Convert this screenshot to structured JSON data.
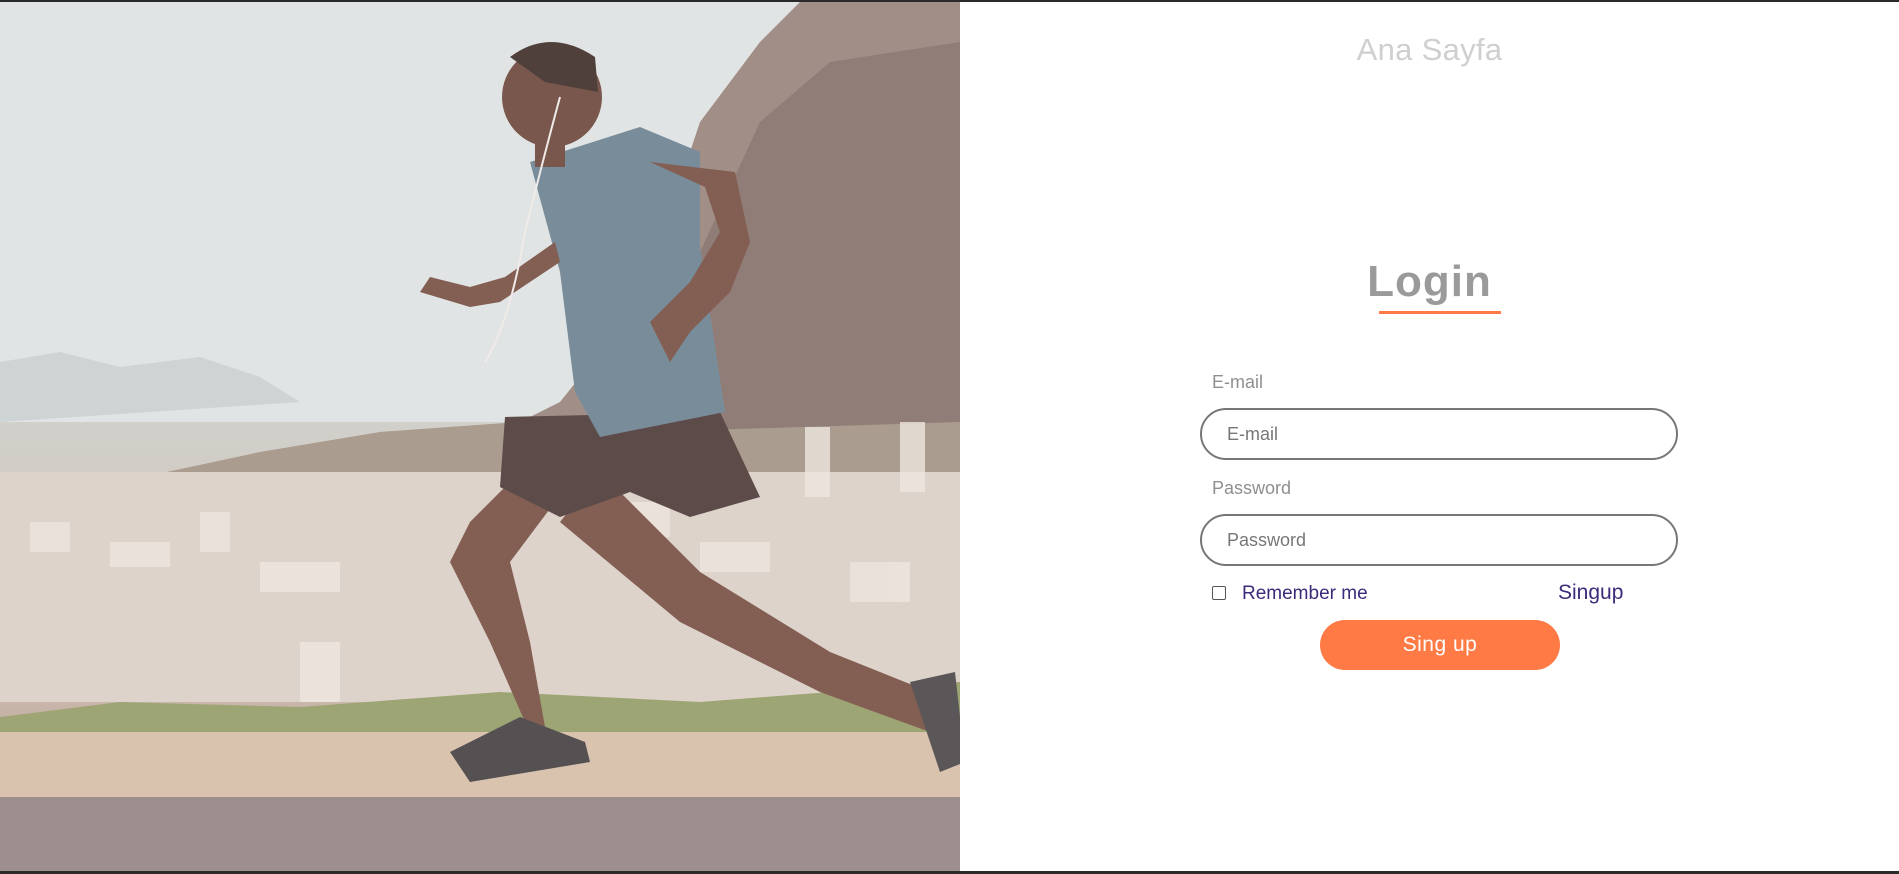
{
  "header": {
    "home_link": "Ana Sayfa"
  },
  "hero": {
    "image": "runner-photo",
    "description_icon": "runner-image"
  },
  "login": {
    "title": "Login",
    "email": {
      "label": "E-mail",
      "placeholder": "E-mail"
    },
    "password": {
      "label": "Password",
      "placeholder": "Password"
    },
    "remember_label": "Remember me",
    "remember_checked": false,
    "signup_link": "Singup",
    "submit_label": "Sing up"
  },
  "colors": {
    "accent": "#ff7a45",
    "link": "#3d2a7a",
    "muted_text": "#9a9a9a"
  }
}
